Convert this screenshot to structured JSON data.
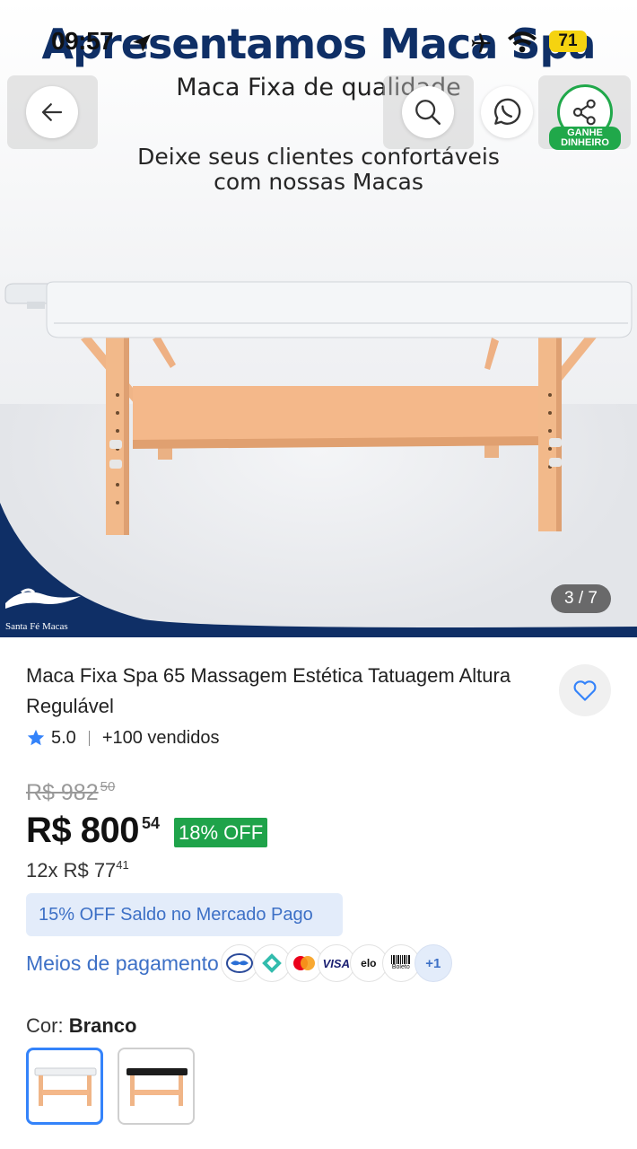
{
  "status_bar": {
    "time": "09:57",
    "battery": "71"
  },
  "hero": {
    "headline": "Apresentamos Maca Spa",
    "subheadline": "Maca Fixa de qualidade",
    "tagline_line1": "Deixe seus clientes confortáveis",
    "tagline_line2": "com nossas Macas",
    "brand_name": "Santa Fé Macas",
    "image_counter": "3 / 7",
    "colors": {
      "navy": "#0f2f66",
      "wood": "#f2b98a",
      "cushion": "#f4f6f8"
    }
  },
  "top_actions": {
    "back_icon": "arrow-left-icon",
    "search_icon": "search-icon",
    "whatsapp_icon": "whatsapp-icon",
    "share_icon": "share-icon",
    "earn_label_line1": "GANHE",
    "earn_label_line2": "DINHEIRO"
  },
  "product": {
    "title": "Maca Fixa Spa 65 Massagem Estética Tatuagem Altura Regulável",
    "rating": "5.0",
    "sold": "+100 vendidos",
    "favorite_icon": "heart-icon"
  },
  "pricing": {
    "old_price": "R$ 982",
    "old_price_cents": "50",
    "price": "R$ 800",
    "price_cents": "54",
    "discount": "18% OFF",
    "installments": "12x R$ 77",
    "installments_cents": "41",
    "promo": "15% OFF Saldo no Mercado Pago",
    "accent_color": "#3d70c6",
    "discount_color": "#1fa34a"
  },
  "payment": {
    "link_label": "Meios de pagamento",
    "methods": [
      "mercado-pago-icon",
      "pix-icon",
      "mastercard-icon",
      "VISA",
      "elo",
      "Boleto"
    ],
    "more": "+1"
  },
  "color_selector": {
    "label": "Cor:",
    "selected": "Branco",
    "options": [
      "white-table-thumb",
      "black-table-thumb"
    ]
  }
}
